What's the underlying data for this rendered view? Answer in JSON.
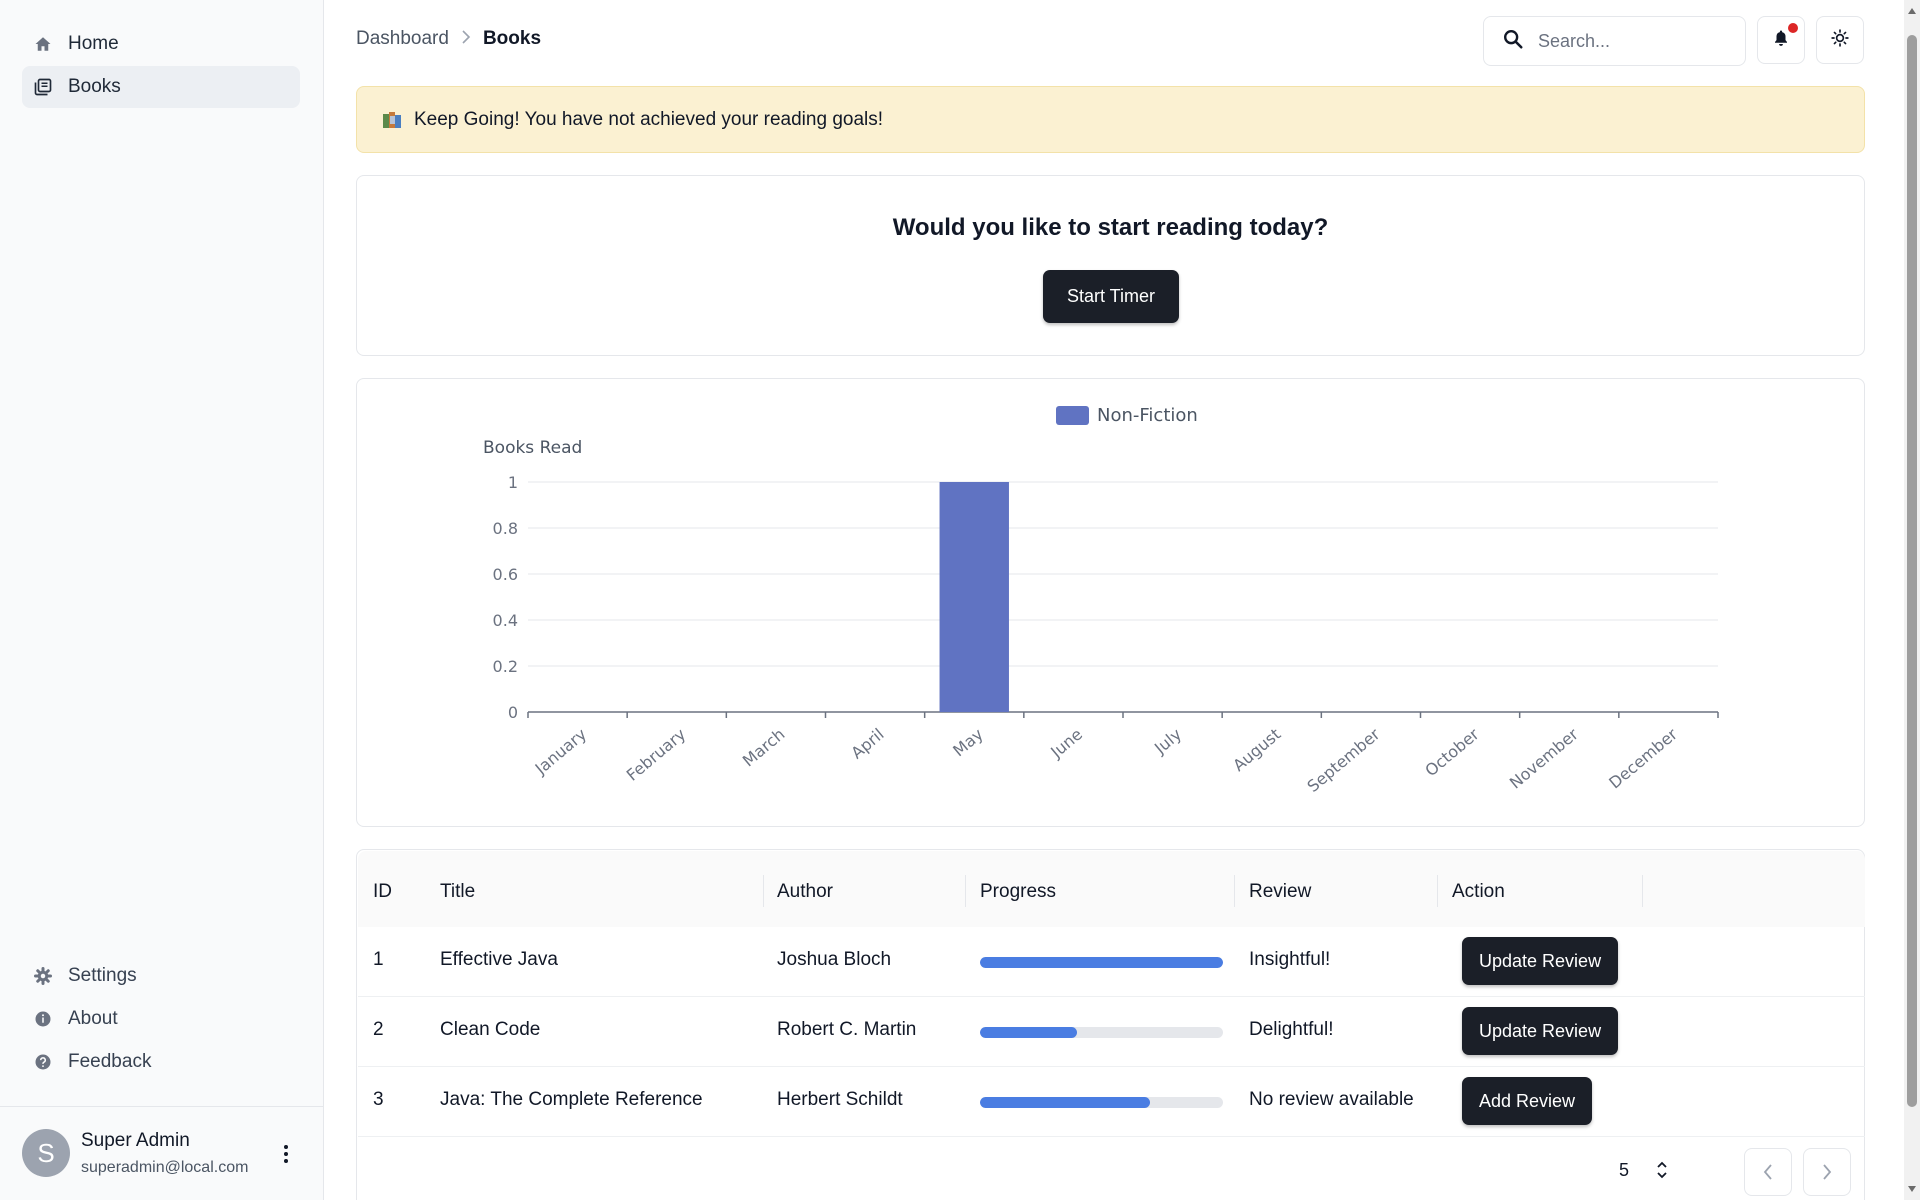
{
  "sidebar": {
    "nav": [
      {
        "label": "Home",
        "icon": "home-icon"
      },
      {
        "label": "Books",
        "icon": "books-icon",
        "active": true
      }
    ],
    "bottom_nav": [
      {
        "label": "Settings",
        "icon": "gear-icon"
      },
      {
        "label": "About",
        "icon": "info-icon"
      },
      {
        "label": "Feedback",
        "icon": "help-icon"
      }
    ],
    "user": {
      "initial": "S",
      "name": "Super Admin",
      "email": "superadmin@local.com"
    }
  },
  "header": {
    "breadcrumb": {
      "parent": "Dashboard",
      "current": "Books"
    },
    "search": {
      "placeholder": "Search..."
    },
    "notification_dot_color": "#dc2626"
  },
  "alert": {
    "text": "Keep Going! You have not achieved your reading goals!",
    "background": "#fbf1d2"
  },
  "timer": {
    "title": "Would you like to start reading today?",
    "button_label": "Start Timer"
  },
  "chart_data": {
    "type": "bar",
    "categories": [
      "January",
      "February",
      "March",
      "April",
      "May",
      "June",
      "July",
      "August",
      "September",
      "October",
      "November",
      "December"
    ],
    "series": [
      {
        "name": "Non-Fiction",
        "color": "#6073c2",
        "values": [
          0,
          0,
          0,
          0,
          1,
          0,
          0,
          0,
          0,
          0,
          0,
          0
        ]
      }
    ],
    "ylabel": "Books Read",
    "xlabel": "",
    "ylim": [
      0,
      1
    ],
    "yticks": [
      "0",
      "0.2",
      "0.4",
      "0.6",
      "0.8",
      "1"
    ],
    "grid": true,
    "legend": "top-center"
  },
  "table": {
    "headers": [
      "ID",
      "Title",
      "Author",
      "Progress",
      "Review",
      "Action"
    ],
    "rows": [
      {
        "id": "1",
        "title": "Effective Java",
        "author": "Joshua Bloch",
        "progress": 1.0,
        "review": "Insightful!",
        "action": "Update Review"
      },
      {
        "id": "2",
        "title": "Clean Code",
        "author": "Robert C. Martin",
        "progress": 0.4,
        "review": "Delightful!",
        "action": "Update Review"
      },
      {
        "id": "3",
        "title": "Java: The Complete Reference",
        "author": "Herbert Schildt",
        "progress": 0.7,
        "review": "No review available",
        "action": "Add Review"
      }
    ],
    "page_size": "5"
  }
}
